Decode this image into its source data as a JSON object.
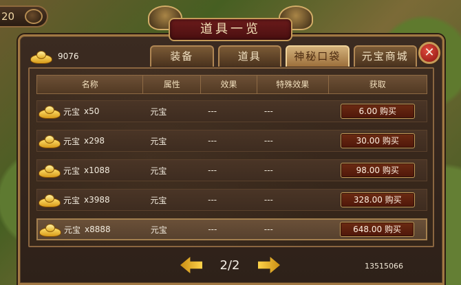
{
  "hud": {
    "level": "20"
  },
  "title": "道具一览",
  "gold": {
    "amount": "9076",
    "icon": "gold-ingot-icon"
  },
  "tabs": [
    {
      "label": "装备",
      "active": false
    },
    {
      "label": "道具",
      "active": false
    },
    {
      "label": "神秘口袋",
      "active": true
    },
    {
      "label": "元宝商城",
      "active": false
    }
  ],
  "close": {
    "label": "✕",
    "icon": "close-icon"
  },
  "table": {
    "headers": [
      "名称",
      "属性",
      "效果",
      "特殊效果",
      "获取"
    ],
    "rows": [
      {
        "name": "元宝",
        "qty": "x50",
        "attr": "元宝",
        "effect": "---",
        "special": "---",
        "price_label": "6.00 购买"
      },
      {
        "name": "元宝",
        "qty": "x298",
        "attr": "元宝",
        "effect": "---",
        "special": "---",
        "price_label": "30.00 购买"
      },
      {
        "name": "元宝",
        "qty": "x1088",
        "attr": "元宝",
        "effect": "---",
        "special": "---",
        "price_label": "98.00 购买"
      },
      {
        "name": "元宝",
        "qty": "x3988",
        "attr": "元宝",
        "effect": "---",
        "special": "---",
        "price_label": "328.00 购买"
      },
      {
        "name": "元宝",
        "qty": "x8888",
        "attr": "元宝",
        "effect": "---",
        "special": "---",
        "price_label": "648.00 购买"
      }
    ]
  },
  "pagination": {
    "label": "2/2",
    "prev_icon": "left-arrow-icon",
    "next_icon": "right-arrow-icon"
  },
  "footer": {
    "id": "13515066"
  },
  "colors": {
    "accent_gold": "#c59b58",
    "tab_active": "#d2b07a",
    "button_red": "#6c2a12"
  }
}
